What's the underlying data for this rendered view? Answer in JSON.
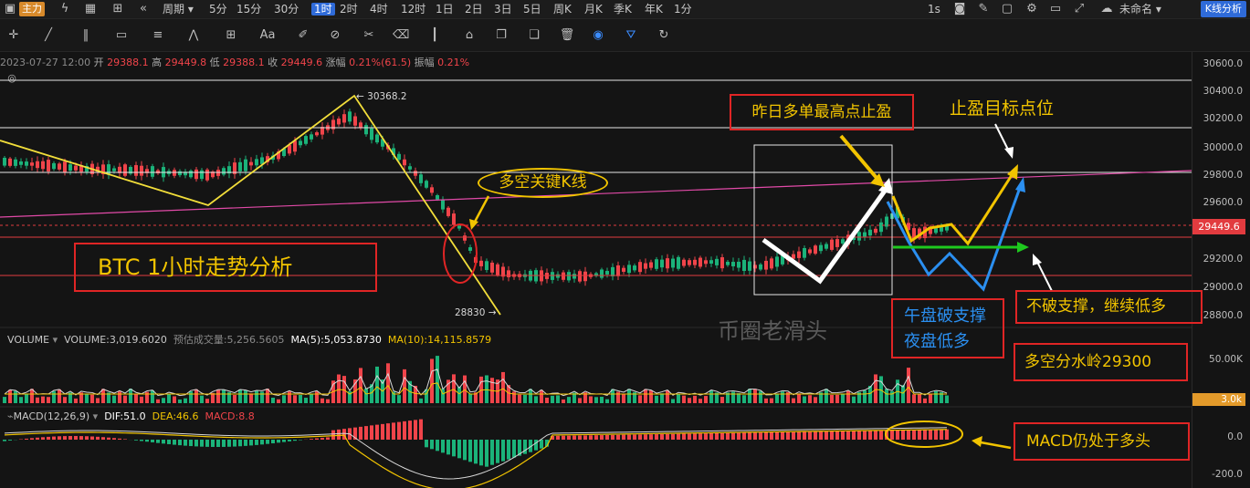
{
  "toolbar": {
    "main_badge": "主力",
    "period_label": "周期",
    "intervals": [
      "5分",
      "15分",
      "30分",
      "1时",
      "2时",
      "4时",
      "12时",
      "1日",
      "2日",
      "3日",
      "5日",
      "周K",
      "月K",
      "季K",
      "年K",
      "1分"
    ],
    "active_interval": "1时",
    "right_speed": "1s",
    "layout_name": "未命名",
    "kline_analysis": "K线分析"
  },
  "tools": {
    "text_tool": "Aa"
  },
  "ohlc": {
    "date": "2023-07-27 12:00",
    "open_label": "开",
    "open": "29388.1",
    "high_label": "高",
    "high": "29449.8",
    "low_label": "低",
    "low": "29388.1",
    "close_label": "收",
    "close": "29449.6",
    "change_label": "涨幅",
    "change": "0.21%(61.5)",
    "amp_label": "振幅",
    "amp": "0.21%"
  },
  "price_axis": {
    "ticks": [
      "30600.0",
      "30400.0",
      "30200.0",
      "30000.0",
      "29800.0",
      "29600.0",
      "29200.0",
      "29000.0",
      "28800.0"
    ],
    "current_price": "29449.6",
    "high_marker": "← 30368.2",
    "low_marker": "28830 →"
  },
  "volume": {
    "title": "VOLUME",
    "volume_text": "VOLUME:3,019.6020",
    "est_text": "预估成交量:5,256.5605",
    "ma5": "MA(5):5,053.8730",
    "ma10": "MA(10):14,115.8579",
    "axis_tick": "50.00K",
    "current": "3.0k"
  },
  "macd": {
    "title": "MACD(12,26,9)",
    "dif": "DIF:51.0",
    "dea": "DEA:46.6",
    "macd": "MACD:8.8",
    "ticks": [
      "0.0",
      "-200.0"
    ]
  },
  "annotations": {
    "title": "BTC  1小时走势分析",
    "key_candle": "多空关键K线",
    "take_profit_yesterday": "昨日多单最高点止盈",
    "take_profit_target": "止盈目标点位",
    "noon_break": "午盘破支撑",
    "night_long": "夜盘低多",
    "no_break": "不破支撑，继续低多",
    "divide": "多空分水岭29300",
    "macd_bull": "MACD仍处于多头"
  },
  "watermark": "币圈老滑头",
  "colors": {
    "up": "#1bb37a",
    "down": "#f0444a",
    "accent": "#2f6bd9",
    "annotation": "#f2c400",
    "box": "#e02525"
  }
}
